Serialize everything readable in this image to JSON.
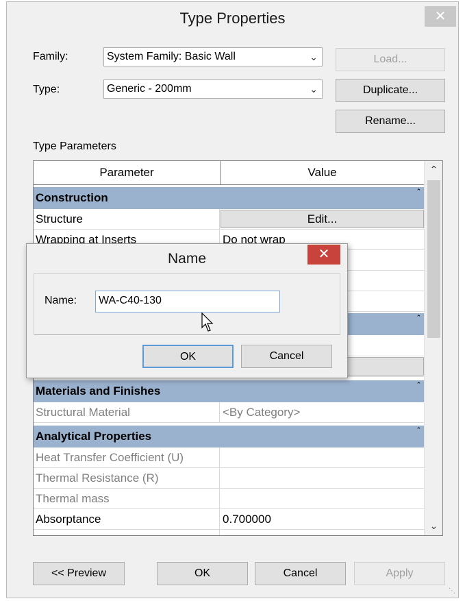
{
  "window": {
    "title": "Type Properties",
    "close_glyph": "✕"
  },
  "family": {
    "label": "Family:",
    "value": "System Family: Basic Wall"
  },
  "type": {
    "label": "Type:",
    "value": "Generic - 200mm"
  },
  "buttons": {
    "load": "Load...",
    "duplicate": "Duplicate...",
    "rename": "Rename..."
  },
  "type_parameters_label": "Type Parameters",
  "grid": {
    "headers": {
      "parameter": "Parameter",
      "value": "Value"
    },
    "groups": {
      "construction": "Construction",
      "materials": "Materials and Finishes",
      "analytical": "Analytical Properties"
    },
    "rows": {
      "structure": {
        "name": "Structure",
        "value": "Edit..."
      },
      "wrapping": {
        "name": "Wrapping at Inserts",
        "value": "Do not wrap"
      },
      "structural_material": {
        "name": "Structural Material",
        "value": "<By Category>"
      },
      "heat_transfer": {
        "name": "Heat Transfer Coefficient (U)",
        "value": ""
      },
      "thermal_resistance": {
        "name": "Thermal Resistance (R)",
        "value": ""
      },
      "thermal_mass": {
        "name": "Thermal mass",
        "value": ""
      },
      "absorptance": {
        "name": "Absorptance",
        "value": "0.700000"
      }
    }
  },
  "name_dialog": {
    "title": "Name",
    "label": "Name:",
    "value": "WA-C40-130",
    "ok": "OK",
    "cancel": "Cancel",
    "close_glyph": "✕"
  },
  "footer": {
    "preview": "<< Preview",
    "ok": "OK",
    "cancel": "Cancel",
    "apply": "Apply"
  }
}
